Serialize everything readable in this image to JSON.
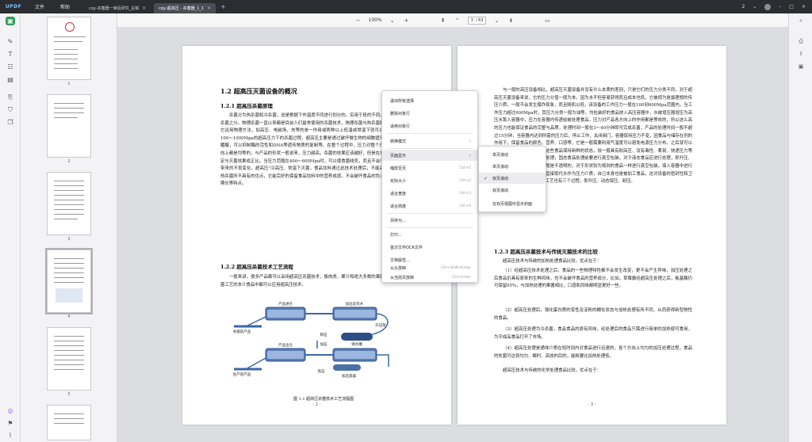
{
  "app": {
    "logo": "UPDF",
    "menus": [
      "文件",
      "帮助"
    ],
    "tabs": [
      {
        "label": "cqy-杀菌器一审后研究_总稿",
        "active": false
      },
      {
        "label": "cqy-超高压 - 杀菌器_1_1",
        "active": true
      }
    ],
    "window_page_indicator": "2",
    "colors": {
      "titlebar": "#2b2d31",
      "accent": "#2f9e59"
    }
  },
  "toolbar": {
    "zoom": "100%",
    "current_page": "3",
    "total_pages": "/ 63"
  },
  "thumbnails": {
    "numbers": [
      "1",
      "2",
      "3",
      "4",
      "5"
    ]
  },
  "left_page": {
    "section_title": "1.2 超高压灭菌设备的概况",
    "sub1_title": "1.2.1 超高压杀菌原理",
    "sub1_text": "杀菌分为热杀菌和冷杀菌，这是根据下作温度不同进行划分的。实用于段的不同，有物理杀菌和化学杀菌之分。物理杀菌一直以来都是目前人们最常使用的杀菌技术，物理杀菌与热杀菌和化学杀菌相比的，它运用物理方法，如高压、电磁场，充等的单一作用或两种以上低温或常温下就可以杀灭细菌。食品在100～1000Mpa的超高压力下的杀菌过程，超高压主要是通过破坏微生物的细胞壁来使其致死的，自然履醒，可以抑制酶的活性和DNA等遗传物质的复制等。在整个过程中，压力对整个产品的作用在各个方向上都是均等的，与产品的形状一般说来，压力越高，杀菌的效果应该越好，但是在食品加工中，受不一定与灭菌效果成正比。当压力范围在400～600Mpa时，可以使食菌线死，而且不会引起一般高温杀菌所带来的不良变化。超高压\"冷高压、常温下灭菌，食品饮料通过此技术处理后，不能高效的杀灭了有传统热杀菌所不具有的优点，它能完好的保留食品饮料中的营养成感，不会破坏食品的色泽，安全性高，保质期长等特点。",
    "sub2_title": "1.2.2 超高压杀菌技术工艺流程",
    "sub2_text": "一般来讲，很多产品都可以采用超高压杀菌技术，像肉类、果汁和绝大多数的果蔬类食品等。这种杀菌工艺的本介食品中都可以应用超高压技术。",
    "diagram_labels": [
      "产品进仓",
      "加压前充水",
      "杀菌前产品",
      "产品出仓",
      "卸压",
      "储水罐",
      "加压",
      "升压泵",
      "生产后产品",
      "高压",
      "加压容器"
    ],
    "figure_caption": "图 1.1 超高压杀菌技术工艺流程图",
    "page_number": "- 2 -"
  },
  "right_page": {
    "intro_text": "与一般的高压设备相比，超高压灭菌设备并没有什么本质的差别，只是它们的压力分类不同，对于超高压灭菌设备来说，它的压力分值一般为本。因为水不但容易获得而且成本也低，它被视为是最理想的传压介质，一般不会发生爆炸现象，而且随机以低，该设备的工作压力一般在100到600Mpa范围内，当工作压力超过600Mpa时，其压力分类一般为油等，均包装好的食品放入高压容器中，水被增压器增压为高压水泵入容器中，压力在容器内传递给被处理食品，压力对产品各方向上的作用都是等效的，所以这么高的压力也能保证食品的完整与品质，处理时间一般在3～40分钟即可完成杀菌，产品的处理时间一般不超过15分钟，当容器内达到所需的压力后，停止工作，关闭阀门，容器保持压力不变，因食品与储存在剂的作用下，保留食品的颜色、营养、口感等，它是一般需要利用气温度可以避免电源压力分布。之后就可以把封好的食品进行加压，使这些食品保持新鲜的状态，较一般具有耐高压、没有毒性、柔韧、快递压力等特点，固态及液态食品均可处理，固态食品处理前要进行真空包装，对于液态食品应进行处理，即升压、保压、卸压。连杆和韧料一般是不透明的，对于形状较为规则的食品一样进行真空包装，填入容器中进行外部加压处理，而且还可以直接取代水作为压力介质，自己本身也是被加工食品，这对设备的密封性和卫生条件等要求比较高，处理工艺也有三个过程，即升压、动态保压、卸压。",
    "sub3_title": "1.2.3 超高压杀菌技术与传统灭菌技术的比较",
    "compare_intro": "超高压技术与传统的加热处理食品比较，优点在于：",
    "point1": "（1）经超高压技术处理之后，食品的一些物理特性都不会发生改变，更不会产生异味，加压处理之后食品仍具有原来的生鲜风味，也不会破坏食品的营养成分，比如，草莓酱经超高压处理之后，氨基酸仍可保留95%，与加热处理的果酱相比，口感和风味都明显更好一些。",
    "point2": "（2）超高压处理后，强化蛋白质的变性及淀粉的糊化状态与加热处理有所不同，从而获得新型物性的食品。",
    "point3": "（3）超高压处理为冷杀菌，食品食品的原有风味，经处理后的食品只需进行简单的加热便可食用，为平成品食品打开了市场。",
    "point4": "（4）超高压处理是通体介质在短时间内对食品进行迅速的，各个方向上均匀的加压处理过程，食品的失菌可达到均匀、瞬时、高效的目的，能耗要比加热处理低。",
    "compare_end": "超高压技术与传统的化学处理食品比较，优点在于：",
    "page_number": "- 3 -"
  },
  "context_menu": {
    "items": [
      {
        "label": "退出所有选择",
        "shortcut": "",
        "submenu": false
      },
      {
        "label": "删除对象行",
        "shortcut": "",
        "submenu": false
      },
      {
        "label": "适用对象行",
        "shortcut": "",
        "submenu": false
      },
      {
        "label": "转换模式",
        "shortcut": "",
        "submenu": true
      },
      {
        "label": "页面显示",
        "shortcut": "",
        "submenu": true
      },
      {
        "label": "缩放至页",
        "shortcut": "Ctrl+1",
        "submenu": false
      },
      {
        "label": "实际大小",
        "shortcut": "Ctrl+2",
        "submenu": false
      },
      {
        "label": "适合宽度",
        "shortcut": "Ctrl+3",
        "submenu": false
      },
      {
        "label": "适合高度",
        "shortcut": "Ctrl+4",
        "submenu": false
      },
      {
        "label": "另存为...",
        "shortcut": "",
        "submenu": false
      },
      {
        "label": "打印...",
        "shortcut": "",
        "submenu": false
      },
      {
        "label": "首次文件OCR文件",
        "shortcut": "",
        "submenu": false
      },
      {
        "label": "文档属性...",
        "shortcut": "",
        "submenu": false
      },
      {
        "label": "从头放映",
        "shortcut": "Ctrl+Shift+Enter",
        "submenu": false
      },
      {
        "label": "从当前页放映",
        "shortcut": "Ctrl+Enter",
        "submenu": false
      }
    ],
    "highlighted_index": 4
  },
  "submenu": {
    "items": [
      {
        "label": "单页滚动",
        "checked": false
      },
      {
        "label": "单页滚动",
        "checked": false
      },
      {
        "label": "双页滚动",
        "checked": true
      },
      {
        "label": "双页滚动",
        "checked": false
      },
      {
        "label": "在双页视图中显示封面",
        "checked": false
      }
    ]
  }
}
